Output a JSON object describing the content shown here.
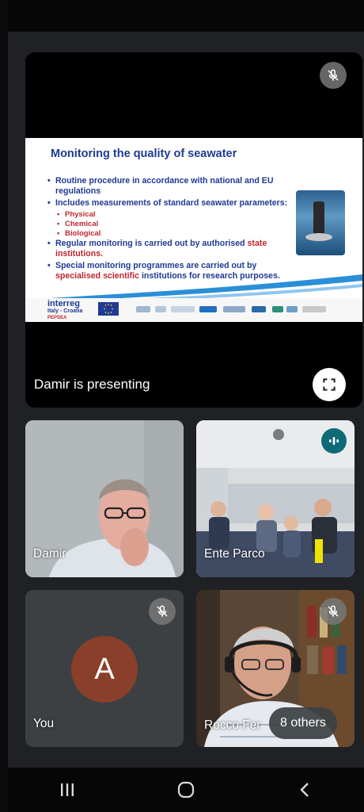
{
  "presentation": {
    "presenting_label": "Damir is presenting",
    "slide": {
      "title": "Monitoring the quality of seawater",
      "bullet_1": "Routine procedure in accordance with national and EU regulations",
      "bullet_2": "Includes measurements of standard seawater parameters:",
      "sub_items": [
        "Physical",
        "Chemical",
        "Biological"
      ],
      "bullet_3_prefix": "Regular monitoring is carried out by authorised",
      "bullet_3_highlight": "state institutions.",
      "bullet_4_prefix": "Special monitoring programmes are carried out by",
      "bullet_4_highlight": "specialised scientific",
      "bullet_4_suffix": "institutions for research purposes.",
      "footer_logo_main": "interreg",
      "footer_logo_sub": "Italy - Croatia",
      "footer_logo_project": "PEPSEA"
    }
  },
  "participants": [
    {
      "name": "Damir"
    },
    {
      "name": "Ente Parco"
    },
    {
      "name": "You",
      "initial": "A"
    },
    {
      "name": "Rocco Fer"
    }
  ],
  "others_chip": "8 others",
  "colors": {
    "background": "#202124",
    "avatar": "#8a3f2a",
    "speaking": "#0f6a78",
    "slide_blue": "#1f3a93",
    "slide_red": "#c0262d"
  },
  "icons": {
    "mic_off": "mic-off-icon",
    "fullscreen": "fullscreen-icon",
    "speaking": "audio-wave-icon",
    "nav_recents": "recents-icon",
    "nav_home": "home-icon",
    "nav_back": "back-icon"
  }
}
